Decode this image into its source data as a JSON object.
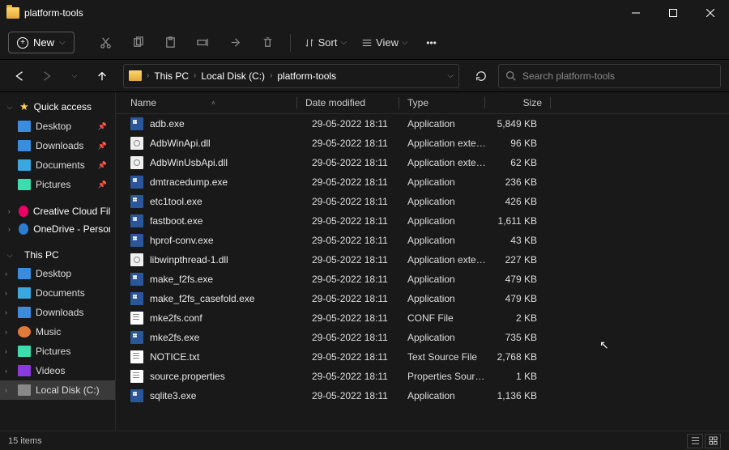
{
  "title": "platform-tools",
  "toolbar": {
    "new": "New",
    "sort": "Sort",
    "view": "View"
  },
  "breadcrumb": [
    "This PC",
    "Local Disk (C:)",
    "platform-tools"
  ],
  "search_placeholder": "Search platform-tools",
  "sidebar": {
    "quick": {
      "label": "Quick access",
      "items": [
        {
          "label": "Desktop",
          "ic": "ic-desktop",
          "pin": true
        },
        {
          "label": "Downloads",
          "ic": "ic-dl",
          "pin": true
        },
        {
          "label": "Documents",
          "ic": "ic-docs",
          "pin": true
        },
        {
          "label": "Pictures",
          "ic": "ic-pics",
          "pin": true
        }
      ]
    },
    "cloud": [
      {
        "label": "Creative Cloud Files",
        "ic": "ic-cc"
      },
      {
        "label": "OneDrive - Persona",
        "ic": "ic-cloud"
      }
    ],
    "thispc": {
      "label": "This PC",
      "items": [
        {
          "label": "Desktop",
          "ic": "ic-desktop"
        },
        {
          "label": "Documents",
          "ic": "ic-docs"
        },
        {
          "label": "Downloads",
          "ic": "ic-dl"
        },
        {
          "label": "Music",
          "ic": "ic-music"
        },
        {
          "label": "Pictures",
          "ic": "ic-pics"
        },
        {
          "label": "Videos",
          "ic": "ic-video"
        },
        {
          "label": "Local Disk (C:)",
          "ic": "ic-disk",
          "hl": true
        }
      ]
    }
  },
  "columns": {
    "name": "Name",
    "date": "Date modified",
    "type": "Type",
    "size": "Size"
  },
  "files": [
    {
      "name": "adb.exe",
      "date": "29-05-2022 18:11",
      "type": "Application",
      "size": "5,849 KB",
      "ic": "ic-app"
    },
    {
      "name": "AdbWinApi.dll",
      "date": "29-05-2022 18:11",
      "type": "Application exten...",
      "size": "96 KB",
      "ic": "ic-dll"
    },
    {
      "name": "AdbWinUsbApi.dll",
      "date": "29-05-2022 18:11",
      "type": "Application exten...",
      "size": "62 KB",
      "ic": "ic-dll"
    },
    {
      "name": "dmtracedump.exe",
      "date": "29-05-2022 18:11",
      "type": "Application",
      "size": "236 KB",
      "ic": "ic-app"
    },
    {
      "name": "etc1tool.exe",
      "date": "29-05-2022 18:11",
      "type": "Application",
      "size": "426 KB",
      "ic": "ic-app"
    },
    {
      "name": "fastboot.exe",
      "date": "29-05-2022 18:11",
      "type": "Application",
      "size": "1,611 KB",
      "ic": "ic-app"
    },
    {
      "name": "hprof-conv.exe",
      "date": "29-05-2022 18:11",
      "type": "Application",
      "size": "43 KB",
      "ic": "ic-app"
    },
    {
      "name": "libwinpthread-1.dll",
      "date": "29-05-2022 18:11",
      "type": "Application exten...",
      "size": "227 KB",
      "ic": "ic-dll"
    },
    {
      "name": "make_f2fs.exe",
      "date": "29-05-2022 18:11",
      "type": "Application",
      "size": "479 KB",
      "ic": "ic-app"
    },
    {
      "name": "make_f2fs_casefold.exe",
      "date": "29-05-2022 18:11",
      "type": "Application",
      "size": "479 KB",
      "ic": "ic-app"
    },
    {
      "name": "mke2fs.conf",
      "date": "29-05-2022 18:11",
      "type": "CONF File",
      "size": "2 KB",
      "ic": "ic-txt"
    },
    {
      "name": "mke2fs.exe",
      "date": "29-05-2022 18:11",
      "type": "Application",
      "size": "735 KB",
      "ic": "ic-app"
    },
    {
      "name": "NOTICE.txt",
      "date": "29-05-2022 18:11",
      "type": "Text Source File",
      "size": "2,768 KB",
      "ic": "ic-txt"
    },
    {
      "name": "source.properties",
      "date": "29-05-2022 18:11",
      "type": "Properties Source ...",
      "size": "1 KB",
      "ic": "ic-txt"
    },
    {
      "name": "sqlite3.exe",
      "date": "29-05-2022 18:11",
      "type": "Application",
      "size": "1,136 KB",
      "ic": "ic-app"
    }
  ],
  "status": "15 items"
}
